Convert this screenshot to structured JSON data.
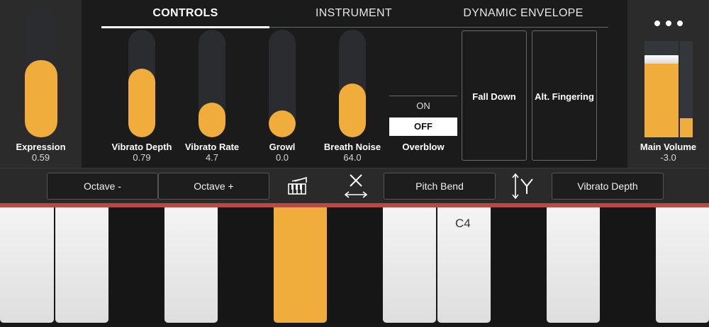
{
  "tabs": [
    {
      "label": "CONTROLS",
      "active": true
    },
    {
      "label": "INSTRUMENT",
      "active": false
    },
    {
      "label": "DYNAMIC ENVELOPE",
      "active": false
    }
  ],
  "expression": {
    "label": "Expression",
    "value": "0.59",
    "level": 0.59
  },
  "sliders": [
    {
      "label": "Vibrato Depth",
      "value": "0.79",
      "level": 0.64
    },
    {
      "label": "Vibrato Rate",
      "value": "4.7",
      "level": 0.32
    },
    {
      "label": "Growl",
      "value": "0.0",
      "level": 0.24
    },
    {
      "label": "Breath Noise",
      "value": "64.0",
      "level": 0.5
    }
  ],
  "overblow": {
    "label": "Overblow",
    "on_label": "ON",
    "off_label": "OFF",
    "selected": "OFF"
  },
  "buttons": {
    "fall_down": "Fall Down",
    "alt_fingering": "Alt. Fingering"
  },
  "main_volume": {
    "label": "Main Volume",
    "value": "-3.0",
    "level": 0.85,
    "meter_level": 0.2
  },
  "menu_icon": "more-dots-icon",
  "toolbar": {
    "octave_minus": "Octave -",
    "octave_plus": "Octave +",
    "x_axis_assign": "Pitch Bend",
    "y_axis_assign": "Vibrato Depth"
  },
  "keyboard": {
    "c4_label": "C4",
    "active_key_index": 3
  },
  "colors": {
    "accent": "#f0ad3c",
    "panel": "#2b2b2b",
    "track": "#2a2c30",
    "red_strip": "#b94a3f"
  }
}
